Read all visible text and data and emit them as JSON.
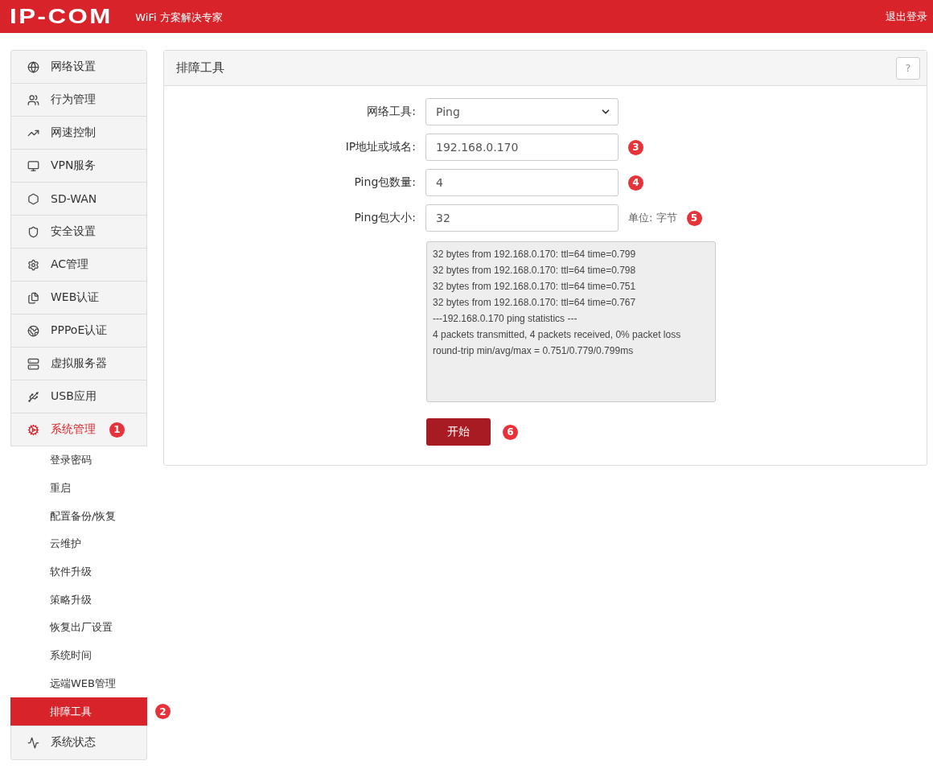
{
  "header": {
    "logo": "IP-COM",
    "tagline": "WiFi 方案解决专家",
    "logout": "退出登录"
  },
  "sidebar": {
    "items": [
      {
        "label": "网络设置",
        "selected": false
      },
      {
        "label": "行为管理",
        "selected": false
      },
      {
        "label": "网速控制",
        "selected": false
      },
      {
        "label": "VPN服务",
        "selected": false
      },
      {
        "label": "SD-WAN",
        "selected": false
      },
      {
        "label": "安全设置",
        "selected": false
      },
      {
        "label": "AC管理",
        "selected": false
      },
      {
        "label": "WEB认证",
        "selected": false
      },
      {
        "label": "PPPoE认证",
        "selected": false
      },
      {
        "label": "虚拟服务器",
        "selected": false
      },
      {
        "label": "USB应用",
        "selected": false
      },
      {
        "label": "系统管理",
        "selected": true,
        "badge": "1",
        "children": [
          {
            "label": "登录密码",
            "selected": false
          },
          {
            "label": "重启",
            "selected": false
          },
          {
            "label": "配置备份/恢复",
            "selected": false
          },
          {
            "label": "云维护",
            "selected": false
          },
          {
            "label": "软件升级",
            "selected": false
          },
          {
            "label": "策略升级",
            "selected": false
          },
          {
            "label": "恢复出厂设置",
            "selected": false
          },
          {
            "label": "系统时间",
            "selected": false
          },
          {
            "label": "远端WEB管理",
            "selected": false
          },
          {
            "label": "排障工具",
            "selected": true,
            "badge": "2"
          }
        ]
      },
      {
        "label": "系统状态",
        "selected": false
      }
    ]
  },
  "panel": {
    "title": "排障工具",
    "help": "?",
    "fields": [
      {
        "kind": "select",
        "label": "网络工具:",
        "value": "Ping"
      },
      {
        "kind": "text",
        "label": "IP地址或域名:",
        "value": "192.168.0.170",
        "badge": "3"
      },
      {
        "kind": "text",
        "label": "Ping包数量:",
        "value": "4",
        "badge": "4"
      },
      {
        "kind": "text",
        "label": "Ping包大小:",
        "value": "32",
        "unit": "单位: 字节",
        "badge": "5"
      }
    ],
    "output": {
      "lines": [
        "32 bytes from 192.168.0.170: ttl=64 time=0.799",
        "32 bytes from 192.168.0.170: ttl=64 time=0.798",
        "32 bytes from 192.168.0.170: ttl=64 time=0.751",
        "32 bytes from 192.168.0.170: ttl=64 time=0.767",
        "---192.168.0.170 ping statistics ---",
        "4 packets transmitted, 4 packets received, 0% packet loss",
        "round-trip min/avg/max = 0.751/0.779/0.799ms"
      ]
    },
    "start_button": {
      "label": "开始",
      "badge": "6"
    }
  }
}
